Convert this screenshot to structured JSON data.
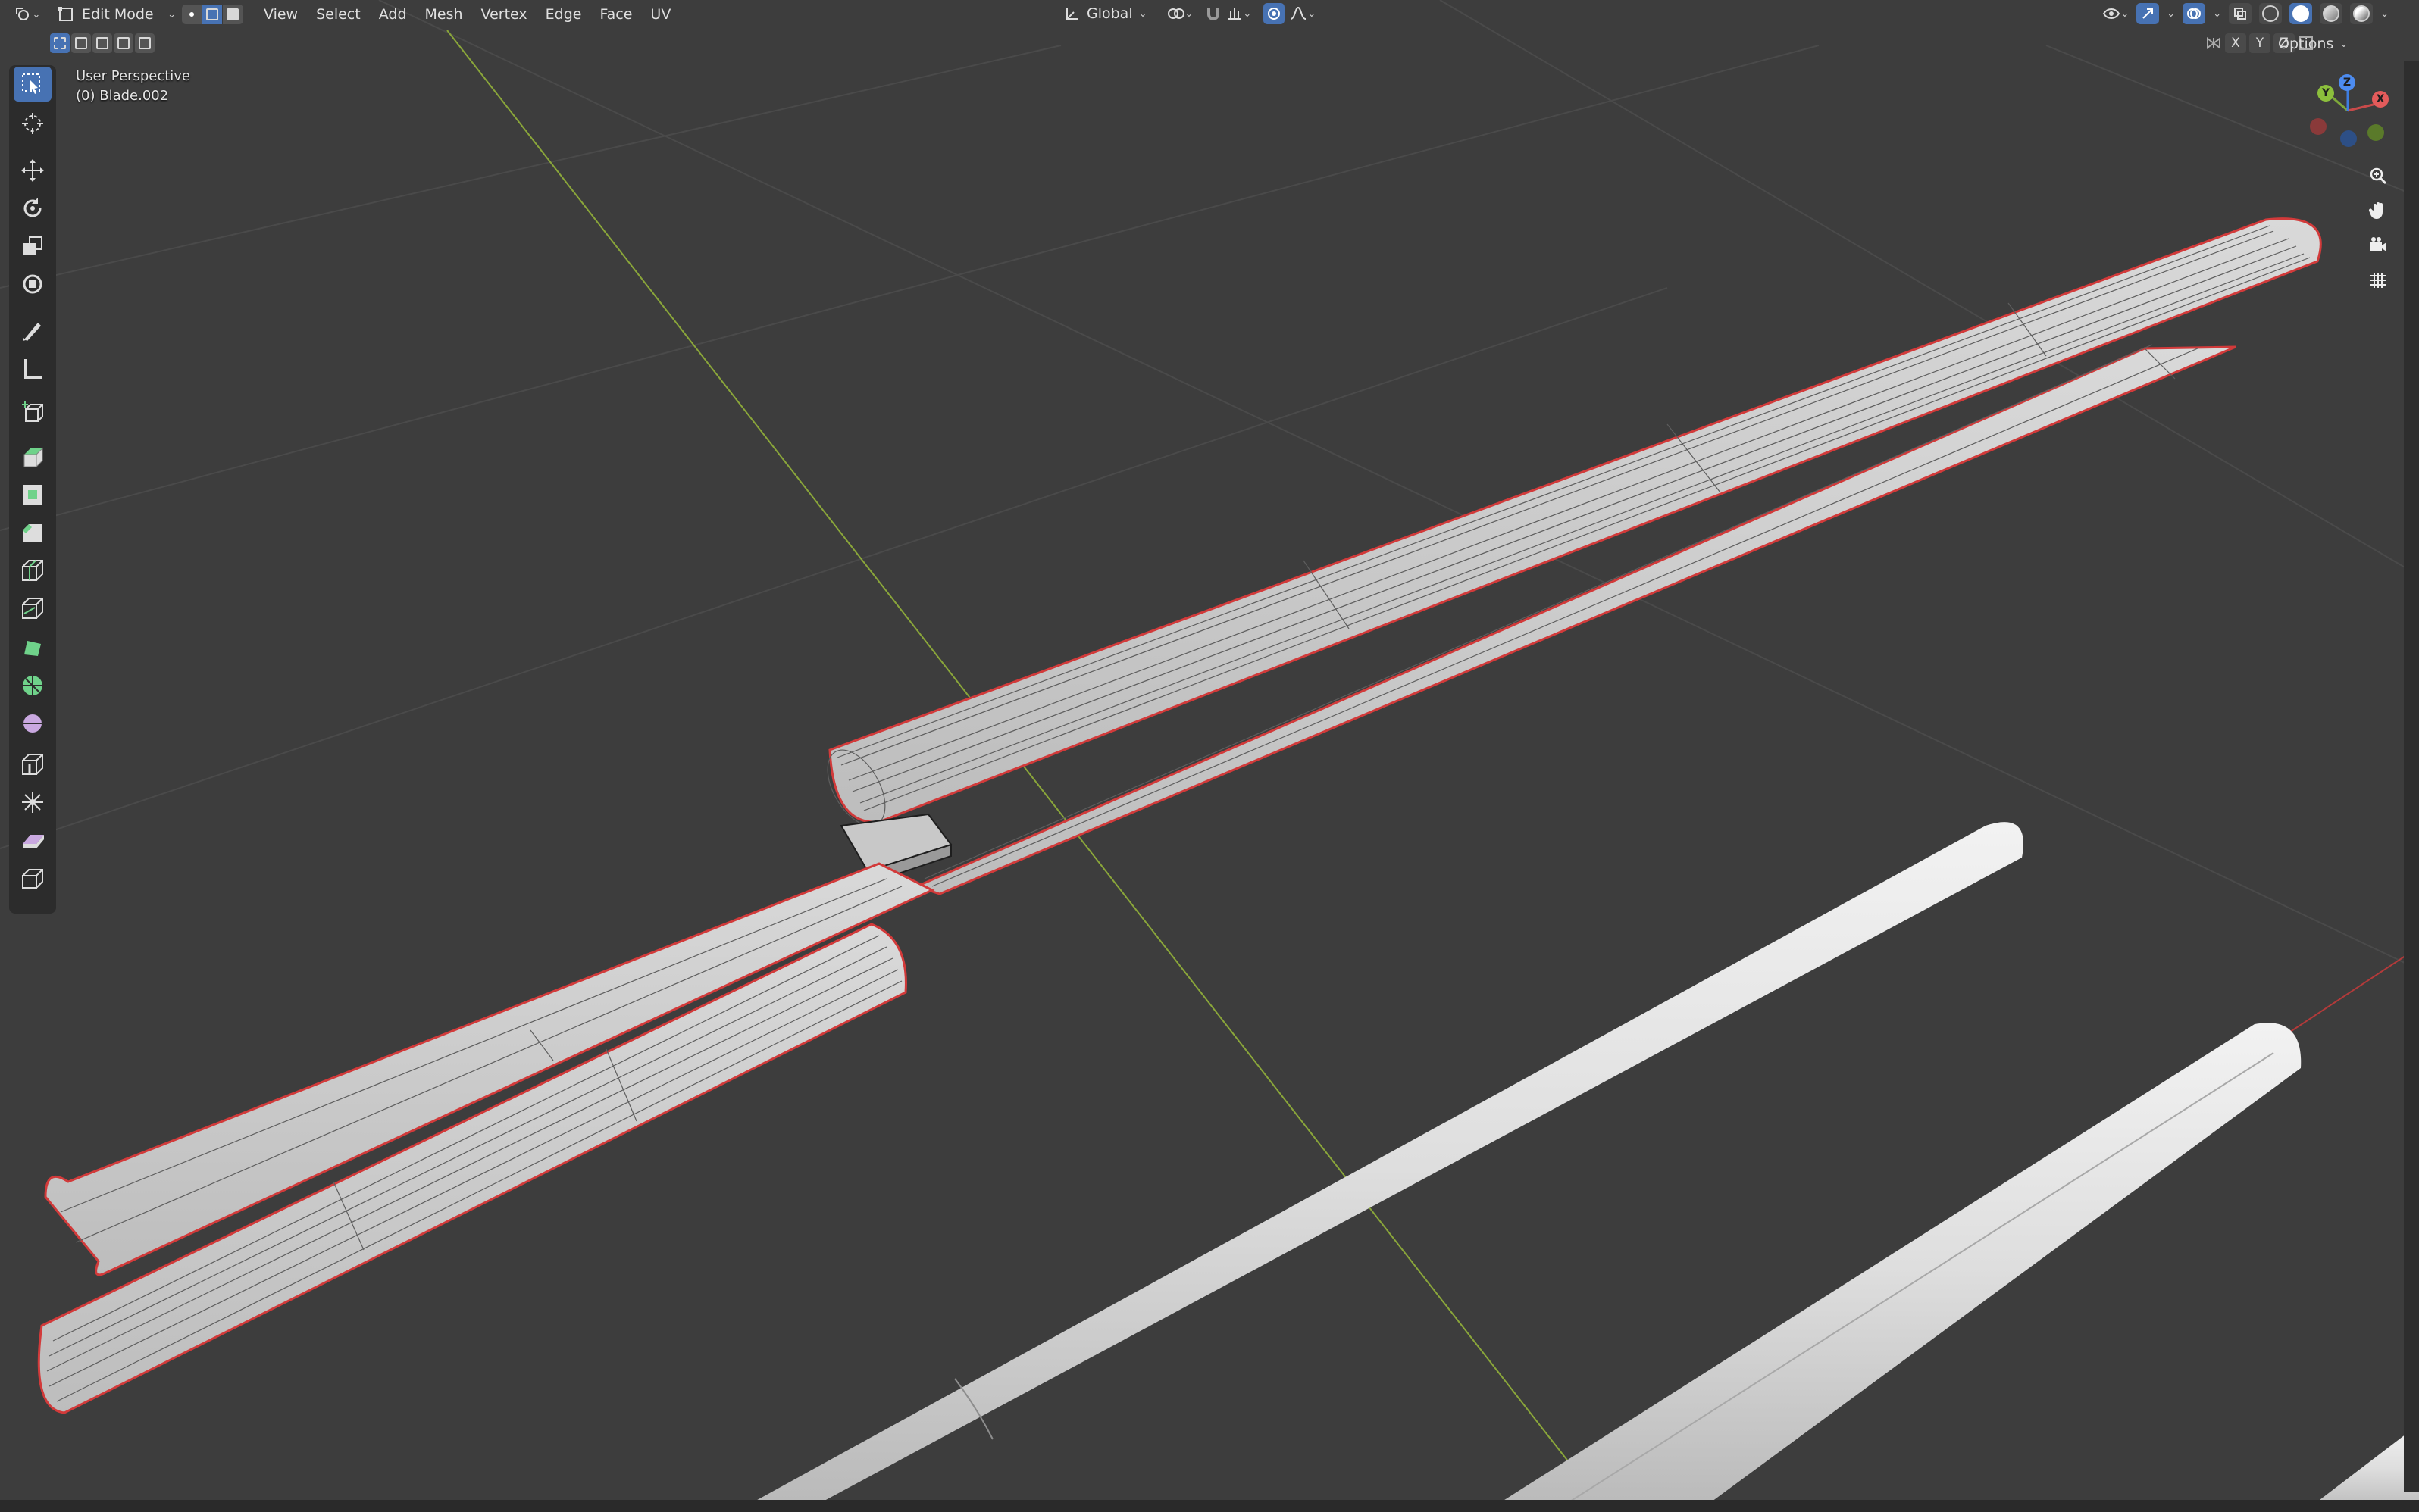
{
  "header": {
    "mode": "Edit Mode",
    "menus": [
      "View",
      "Select",
      "Add",
      "Mesh",
      "Vertex",
      "Edge",
      "Face",
      "UV"
    ],
    "transform_orientation": "Global",
    "mirror_axes": [
      "X",
      "Y",
      "Z"
    ],
    "options_label": "Options"
  },
  "viewport": {
    "view_name": "User Perspective",
    "object_name": "(0) Blade.002"
  },
  "gizmo": {
    "x_label": "X",
    "y_label": "Y",
    "z_label": "Z"
  },
  "icons": {
    "editor_type": "viewport-icon",
    "tools": [
      "select-box-icon",
      "cursor-icon",
      "move-icon",
      "rotate-icon",
      "scale-icon",
      "transform-icon",
      "annotate-icon",
      "measure-icon",
      "add-cube-icon",
      "extrude-icon",
      "inset-icon",
      "bevel-icon",
      "loop-cut-icon",
      "knife-icon",
      "poly-build-icon",
      "spin-icon",
      "smooth-icon",
      "edge-slide-icon",
      "shrink-fatten-icon",
      "shear-icon",
      "rip-icon"
    ],
    "navigation": [
      "zoom-icon",
      "hand-pan-icon",
      "camera-icon",
      "grid-icon"
    ]
  },
  "colors": {
    "background": "#3d3d3d",
    "active_blue": "#4772b3",
    "selection_outline": "#d23a3a",
    "y_axis_line": "#8aa63a",
    "x_axis_line": "#b33a3a"
  }
}
